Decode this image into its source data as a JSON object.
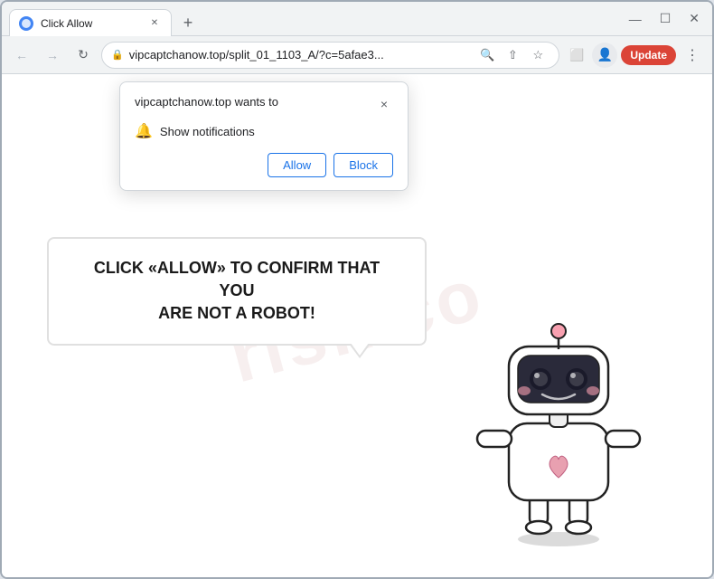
{
  "browser": {
    "tab": {
      "title": "Click Allow",
      "favicon_color": "#4285f4"
    },
    "url": "vipcaptchanow.top/split_01_1103_A/?c=5afae3...",
    "update_button": "Update"
  },
  "notification_popup": {
    "site": "vipcaptchanow.top wants to",
    "permission": "Show notifications",
    "allow_label": "Allow",
    "block_label": "Block",
    "close_label": "×"
  },
  "page": {
    "bubble_text_line1": "CLICK «ALLOW» TO CONFIRM THAT YOU",
    "bubble_text_line2": "ARE NOT A ROBOT!",
    "watermark": "risk.co"
  },
  "window_controls": {
    "minimize": "—",
    "maximize": "☐",
    "close": "✕"
  }
}
